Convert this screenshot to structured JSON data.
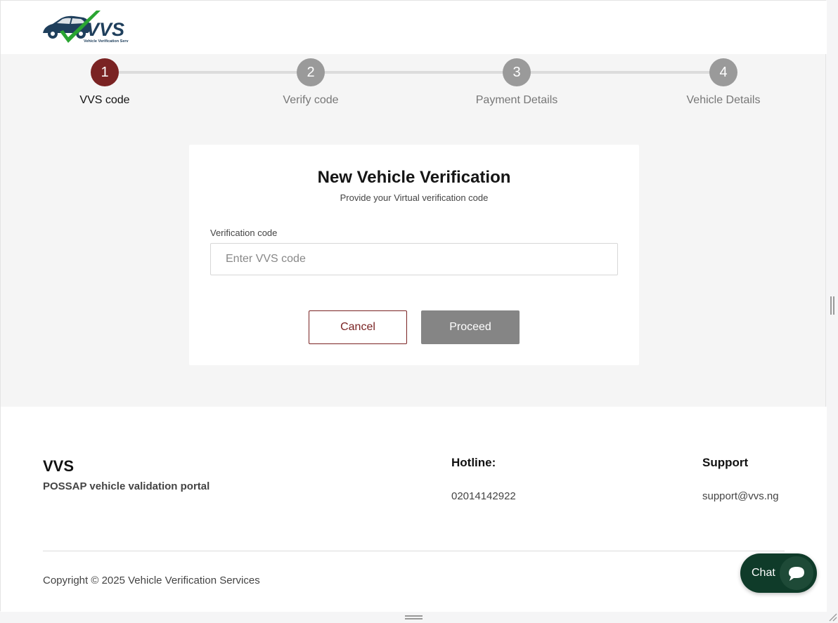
{
  "header": {
    "logo_text": "VVS",
    "logo_subtext": "Vehicle Verification Services"
  },
  "stepper": {
    "steps": [
      {
        "number": "1",
        "label": "VVS code",
        "state": "active"
      },
      {
        "number": "2",
        "label": "Verify code",
        "state": "inactive"
      },
      {
        "number": "3",
        "label": "Payment Details",
        "state": "inactive"
      },
      {
        "number": "4",
        "label": "Vehicle Details",
        "state": "inactive"
      }
    ]
  },
  "form": {
    "title": "New Vehicle Verification",
    "subtitle": "Provide your Virtual verification code",
    "field_label": "Verification code",
    "field_value": "",
    "field_placeholder": "Enter VVS code",
    "cancel_label": "Cancel",
    "proceed_label": "Proceed"
  },
  "footer": {
    "brand": "VVS",
    "tagline": "POSSAP vehicle validation portal",
    "hotline_heading": "Hotline:",
    "hotline_value": "02014142922",
    "support_heading": "Support",
    "support_value": "support@vvs.ng",
    "copyright": "Copyright © 2025 Vehicle Verification Services"
  },
  "chat": {
    "label": "Chat",
    "icon": "chat-bubble-icon"
  },
  "colors": {
    "brand_maroon": "#7a2323",
    "inactive_step": "#9a9a9a",
    "proceed_disabled": "#858585",
    "chat_green": "#0f3b29",
    "logo_navy": "#1f3f5c",
    "logo_check_green": "#2aa532"
  }
}
